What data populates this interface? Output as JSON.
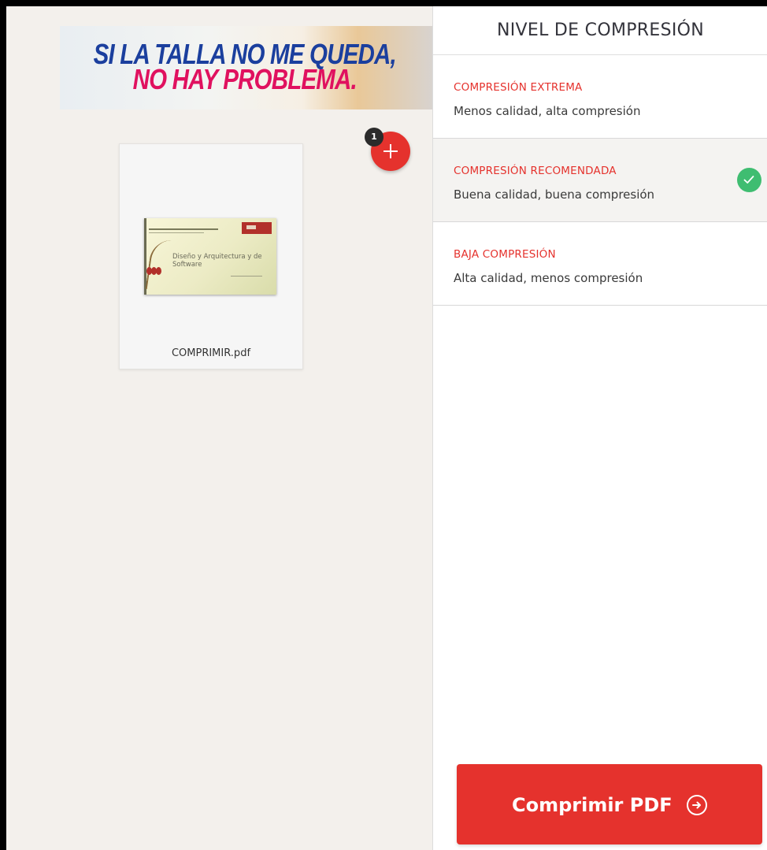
{
  "ad": {
    "line1": "SI LA TALLA NO ME QUEDA,",
    "line2": "NO HAY PROBLEMA."
  },
  "workspace": {
    "file_count_badge": "1",
    "file": {
      "name": "COMPRIMIR.pdf",
      "thumbnail_title": "Diseño y Arquitectura y de Software"
    }
  },
  "sidebar": {
    "title": "NIVEL DE COMPRESIÓN",
    "options": [
      {
        "title": "COMPRESIÓN EXTREMA",
        "description": "Menos calidad, alta compresión",
        "selected": false
      },
      {
        "title": "COMPRESIÓN RECOMENDADA",
        "description": "Buena calidad, buena compresión",
        "selected": true
      },
      {
        "title": "BAJA COMPRESIÓN",
        "description": "Alta calidad, menos compresión",
        "selected": false
      }
    ],
    "submit_label": "Comprimir PDF"
  },
  "colors": {
    "accent": "#e5322d",
    "success": "#3fbd71",
    "workspace_bg": "#f3f0ec"
  },
  "icons": {
    "add": "plus-icon",
    "selected": "check-icon",
    "submit": "arrow-right-circle-icon"
  }
}
